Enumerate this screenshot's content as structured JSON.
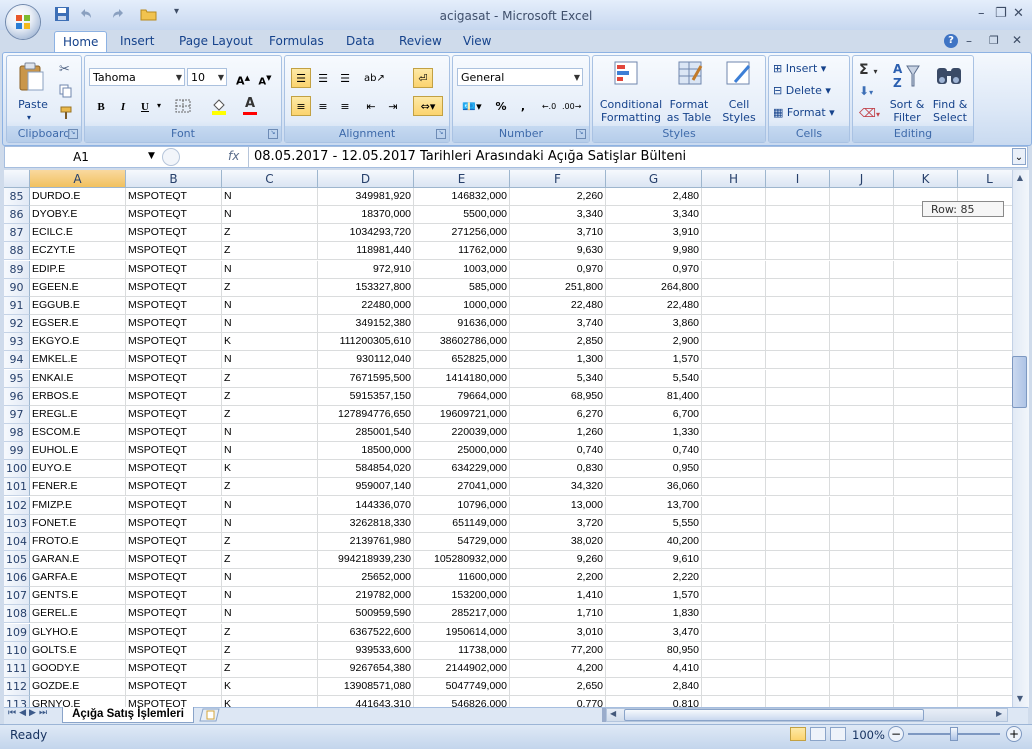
{
  "window": {
    "title": "acigasat - Microsoft Excel",
    "minimize": "–",
    "restore": "❐",
    "close": "✕"
  },
  "ribbon_tabs": [
    "Home",
    "Insert",
    "Page Layout",
    "Formulas",
    "Data",
    "Review",
    "View"
  ],
  "active_tab": "Home",
  "ribbon": {
    "clipboard": {
      "label": "Clipboard",
      "paste": "Paste"
    },
    "font": {
      "label": "Font",
      "name": "Tahoma",
      "size": "10",
      "bold": "B",
      "italic": "I",
      "underline": "U"
    },
    "alignment": {
      "label": "Alignment"
    },
    "number": {
      "label": "Number",
      "format": "General",
      "percent": "%",
      "comma": ","
    },
    "styles": {
      "label": "Styles",
      "conditional": "Conditional Formatting",
      "format_table": "Format as Table",
      "cell_styles": "Cell Styles"
    },
    "cells": {
      "label": "Cells",
      "insert": "Insert",
      "delete": "Delete",
      "format": "Format"
    },
    "editing": {
      "label": "Editing",
      "sort": "Sort & Filter",
      "find": "Find & Select"
    }
  },
  "formula_bar": {
    "name_box": "A1",
    "fx": "fx",
    "content": "08.05.2017 - 12.05.2017 Tarihleri Arasındaki Açığa Satişlar Bülteni"
  },
  "columns": [
    "A",
    "B",
    "C",
    "D",
    "E",
    "F",
    "G",
    "H",
    "I",
    "J",
    "K",
    "L"
  ],
  "rows": [
    {
      "n": "85",
      "cells": [
        "DURDO.E",
        "MSPOTEQT",
        "N",
        "349981,920",
        "146832,000",
        "2,260",
        "2,480"
      ]
    },
    {
      "n": "86",
      "cells": [
        "DYOBY.E",
        "MSPOTEQT",
        "N",
        "18370,000",
        "5500,000",
        "3,340",
        "3,340"
      ]
    },
    {
      "n": "87",
      "cells": [
        "ECILC.E",
        "MSPOTEQT",
        "Z",
        "1034293,720",
        "271256,000",
        "3,710",
        "3,910"
      ]
    },
    {
      "n": "88",
      "cells": [
        "ECZYT.E",
        "MSPOTEQT",
        "Z",
        "118981,440",
        "11762,000",
        "9,630",
        "9,980"
      ]
    },
    {
      "n": "89",
      "cells": [
        "EDIP.E",
        "MSPOTEQT",
        "N",
        "972,910",
        "1003,000",
        "0,970",
        "0,970"
      ]
    },
    {
      "n": "90",
      "cells": [
        "EGEEN.E",
        "MSPOTEQT",
        "Z",
        "153327,800",
        "585,000",
        "251,800",
        "264,800"
      ]
    },
    {
      "n": "91",
      "cells": [
        "EGGUB.E",
        "MSPOTEQT",
        "N",
        "22480,000",
        "1000,000",
        "22,480",
        "22,480"
      ]
    },
    {
      "n": "92",
      "cells": [
        "EGSER.E",
        "MSPOTEQT",
        "N",
        "349152,380",
        "91636,000",
        "3,740",
        "3,860"
      ]
    },
    {
      "n": "93",
      "cells": [
        "EKGYO.E",
        "MSPOTEQT",
        "K",
        "111200305,610",
        "38602786,000",
        "2,850",
        "2,900"
      ]
    },
    {
      "n": "94",
      "cells": [
        "EMKEL.E",
        "MSPOTEQT",
        "N",
        "930112,040",
        "652825,000",
        "1,300",
        "1,570"
      ]
    },
    {
      "n": "95",
      "cells": [
        "ENKAI.E",
        "MSPOTEQT",
        "Z",
        "7671595,500",
        "1414180,000",
        "5,340",
        "5,540"
      ]
    },
    {
      "n": "96",
      "cells": [
        "ERBOS.E",
        "MSPOTEQT",
        "Z",
        "5915357,150",
        "79664,000",
        "68,950",
        "81,400"
      ]
    },
    {
      "n": "97",
      "cells": [
        "EREGL.E",
        "MSPOTEQT",
        "Z",
        "127894776,650",
        "19609721,000",
        "6,270",
        "6,700"
      ]
    },
    {
      "n": "98",
      "cells": [
        "ESCOM.E",
        "MSPOTEQT",
        "N",
        "285001,540",
        "220039,000",
        "1,260",
        "1,330"
      ]
    },
    {
      "n": "99",
      "cells": [
        "EUHOL.E",
        "MSPOTEQT",
        "N",
        "18500,000",
        "25000,000",
        "0,740",
        "0,740"
      ]
    },
    {
      "n": "100",
      "cells": [
        "EUYO.E",
        "MSPOTEQT",
        "K",
        "584854,020",
        "634229,000",
        "0,830",
        "0,950"
      ]
    },
    {
      "n": "101",
      "cells": [
        "FENER.E",
        "MSPOTEQT",
        "Z",
        "959007,140",
        "27041,000",
        "34,320",
        "36,060"
      ]
    },
    {
      "n": "102",
      "cells": [
        "FMIZP.E",
        "MSPOTEQT",
        "N",
        "144336,070",
        "10796,000",
        "13,000",
        "13,700"
      ]
    },
    {
      "n": "103",
      "cells": [
        "FONET.E",
        "MSPOTEQT",
        "N",
        "3262818,330",
        "651149,000",
        "3,720",
        "5,550"
      ]
    },
    {
      "n": "104",
      "cells": [
        "FROTO.E",
        "MSPOTEQT",
        "Z",
        "2139761,980",
        "54729,000",
        "38,020",
        "40,200"
      ]
    },
    {
      "n": "105",
      "cells": [
        "GARAN.E",
        "MSPOTEQT",
        "Z",
        "994218939,230",
        "105280932,000",
        "9,260",
        "9,610"
      ]
    },
    {
      "n": "106",
      "cells": [
        "GARFA.E",
        "MSPOTEQT",
        "N",
        "25652,000",
        "11600,000",
        "2,200",
        "2,220"
      ]
    },
    {
      "n": "107",
      "cells": [
        "GENTS.E",
        "MSPOTEQT",
        "N",
        "219782,000",
        "153200,000",
        "1,410",
        "1,570"
      ]
    },
    {
      "n": "108",
      "cells": [
        "GEREL.E",
        "MSPOTEQT",
        "N",
        "500959,590",
        "285217,000",
        "1,710",
        "1,830"
      ]
    },
    {
      "n": "109",
      "cells": [
        "GLYHO.E",
        "MSPOTEQT",
        "Z",
        "6367522,600",
        "1950614,000",
        "3,010",
        "3,470"
      ]
    },
    {
      "n": "110",
      "cells": [
        "GOLTS.E",
        "MSPOTEQT",
        "Z",
        "939533,600",
        "11738,000",
        "77,200",
        "80,950"
      ]
    },
    {
      "n": "111",
      "cells": [
        "GOODY.E",
        "MSPOTEQT",
        "Z",
        "9267654,380",
        "2144902,000",
        "4,200",
        "4,410"
      ]
    },
    {
      "n": "112",
      "cells": [
        "GOZDE.E",
        "MSPOTEQT",
        "K",
        "13908571,080",
        "5047749,000",
        "2,650",
        "2,840"
      ]
    },
    {
      "n": "113",
      "cells": [
        "GRNYO.E",
        "MSPOTEQT",
        "K",
        "441643,310",
        "546826,000",
        "0,770",
        "0,810"
      ]
    }
  ],
  "row_tooltip": "Row: 85",
  "sheet_tab": "Açığa Satış İşlemleri",
  "status": {
    "ready": "Ready",
    "zoom": "100%"
  },
  "colors": {
    "accent": "#15428b",
    "selected_header": "#f1c15f",
    "ribbon_bg": "#dde8f7"
  }
}
